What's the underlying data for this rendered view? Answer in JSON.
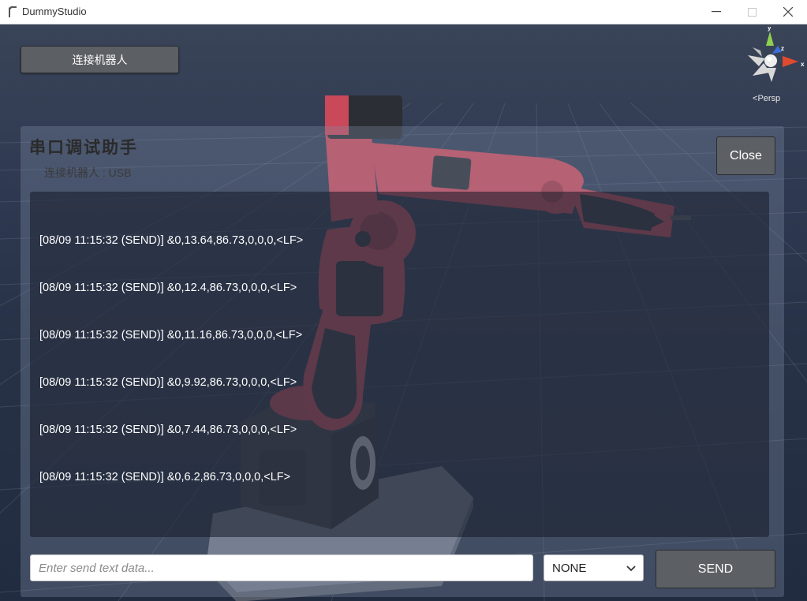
{
  "window": {
    "title": "DummyStudio"
  },
  "toolbar": {
    "connect_label": "连接机器人"
  },
  "viewport": {
    "projection_label": "Persp",
    "axes": {
      "x": "x",
      "y": "y",
      "z": "z"
    },
    "colors": {
      "x_axis": "#e04a2e",
      "y_axis": "#8fd14f",
      "z_axis": "#3a6fd8",
      "robot_body": "#cf4a5a",
      "robot_dark": "#33363d"
    }
  },
  "serial_panel": {
    "title": "串口调试助手",
    "subtitle": "连接机器人 : USB",
    "close_label": "Close",
    "log_lines": [
      "[08/09 11:15:32 (SEND)] &0,13.64,86.73,0,0,0,<LF>",
      "[08/09 11:15:32 (SEND)] &0,12.4,86.73,0,0,0,<LF>",
      "[08/09 11:15:32 (SEND)] &0,11.16,86.73,0,0,0,<LF>",
      "[08/09 11:15:32 (SEND)] &0,9.92,86.73,0,0,0,<LF>",
      "[08/09 11:15:32 (SEND)] &0,7.44,86.73,0,0,0,<LF>",
      "[08/09 11:15:32 (SEND)] &0,6.2,86.73,0,0,0,<LF>"
    ],
    "input": {
      "placeholder": "Enter send text data...",
      "value": ""
    },
    "line_ending": {
      "selected": "NONE"
    },
    "send_label": "SEND"
  }
}
